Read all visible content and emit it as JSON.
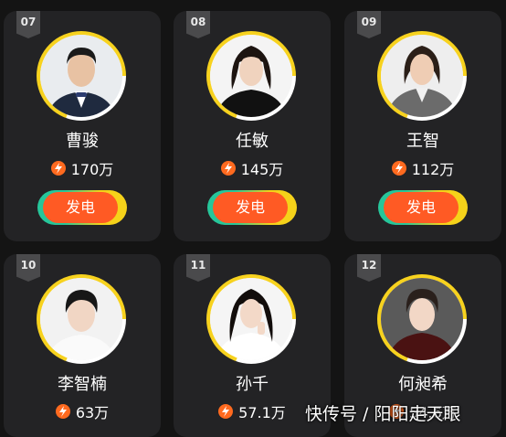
{
  "cards": [
    {
      "rank": "07",
      "name": "曹骏",
      "votes": "170万",
      "button": "发电"
    },
    {
      "rank": "08",
      "name": "任敏",
      "votes": "145万",
      "button": "发电"
    },
    {
      "rank": "09",
      "name": "王智",
      "votes": "112万",
      "button": "发电"
    },
    {
      "rank": "10",
      "name": "李智楠",
      "votes": "63万",
      "button": ""
    },
    {
      "rank": "11",
      "name": "孙千",
      "votes": "57.1万",
      "button": ""
    },
    {
      "rank": "12",
      "name": "何昶希",
      "votes": "54.6万",
      "button": ""
    }
  ],
  "watermark": "快传号 / 阳阳走天眼",
  "colors": {
    "background": "#141414",
    "card": "#232325",
    "accent_orange": "#ff5a24",
    "ring_yellow": "#f7d21e",
    "button_green": "#26c69a"
  },
  "icons": {
    "vote": "lightning-bolt-icon"
  }
}
